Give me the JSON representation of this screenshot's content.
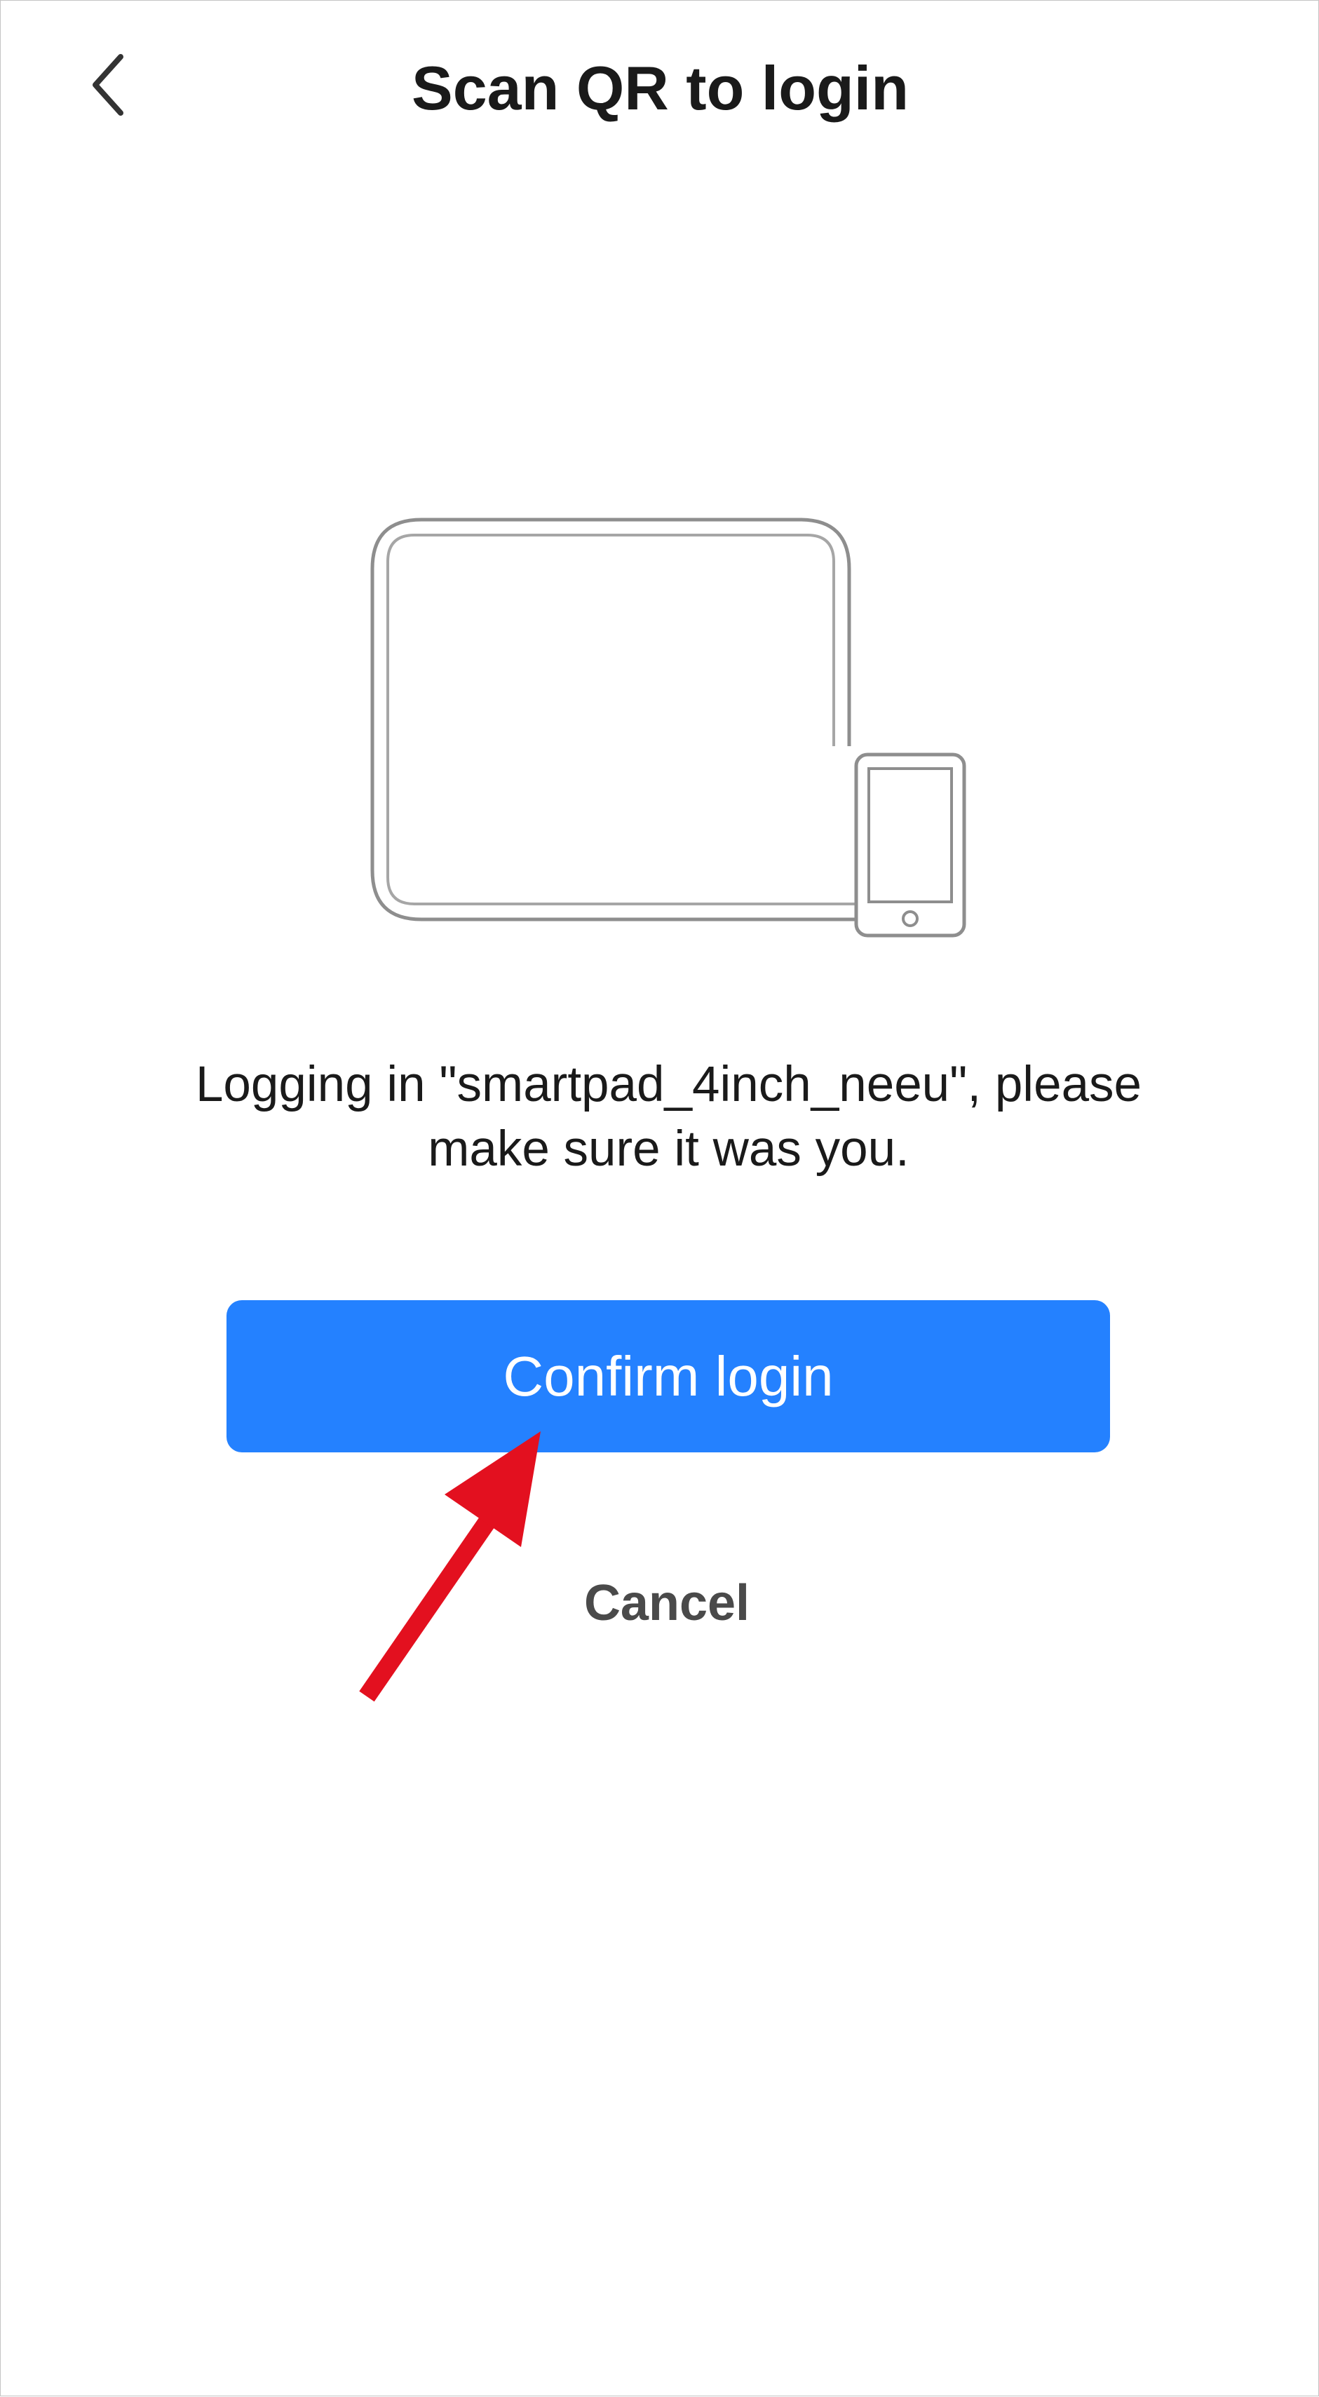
{
  "header": {
    "title": "Scan QR to login",
    "back_icon": "chevron-left-icon"
  },
  "illustration": {
    "icon": "tablet-and-phone-icon"
  },
  "message": {
    "line1": "Logging in \"smartpad_4inch_neeu\", please",
    "line2": "make sure it was you."
  },
  "actions": {
    "confirm_label": "Confirm login",
    "cancel_label": "Cancel"
  },
  "annotation": {
    "icon": "pointer-arrow-icon",
    "color": "#e3101f"
  },
  "colors": {
    "accent": "#2481ff",
    "illustration_stroke": "#8e8e8e"
  }
}
